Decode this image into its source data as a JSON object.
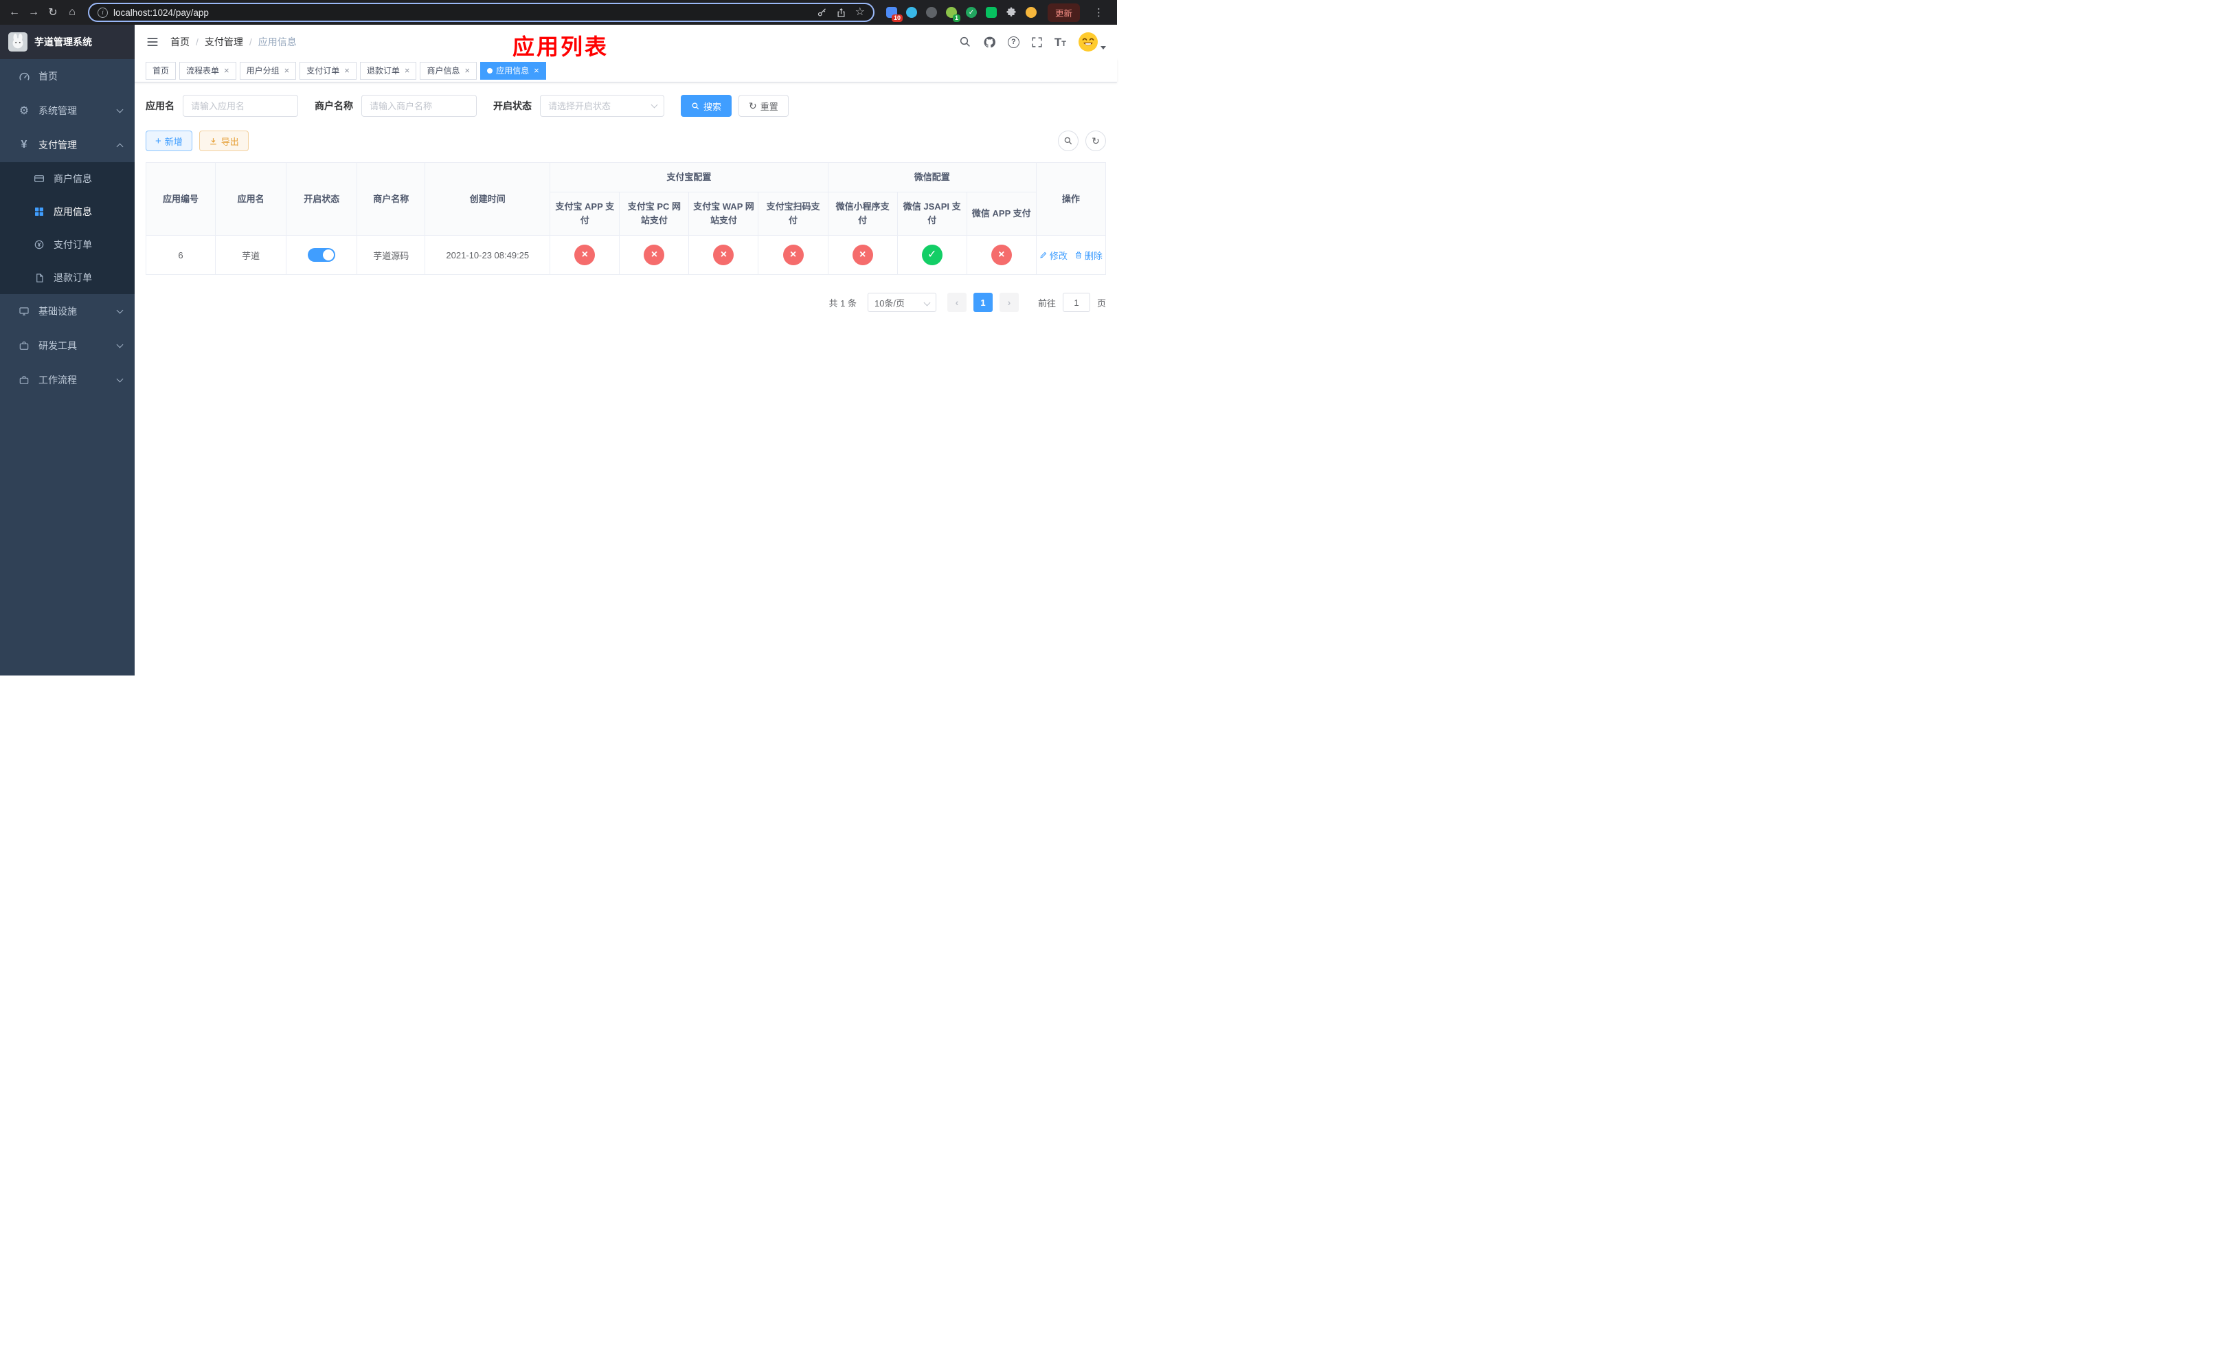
{
  "browser": {
    "url": "localhost:1024/pay/app",
    "update_label": "更新",
    "extension_badge_count": "10",
    "profile_badge_count": "1"
  },
  "sidebar": {
    "title": "芋道管理系统",
    "items": [
      {
        "label": "首页"
      },
      {
        "label": "系统管理"
      },
      {
        "label": "支付管理"
      },
      {
        "label": "基础设施"
      },
      {
        "label": "研发工具"
      },
      {
        "label": "工作流程"
      }
    ],
    "payment_submenu": [
      {
        "label": "商户信息"
      },
      {
        "label": "应用信息"
      },
      {
        "label": "支付订单"
      },
      {
        "label": "退款订单"
      }
    ]
  },
  "header": {
    "breadcrumb": [
      "首页",
      "支付管理",
      "应用信息"
    ],
    "page_title": "应用列表"
  },
  "tabs": [
    {
      "label": "首页"
    },
    {
      "label": "流程表单"
    },
    {
      "label": "用户分组"
    },
    {
      "label": "支付订单"
    },
    {
      "label": "退款订单"
    },
    {
      "label": "商户信息"
    },
    {
      "label": "应用信息"
    }
  ],
  "filters": {
    "app_name_label": "应用名",
    "app_name_placeholder": "请输入应用名",
    "merchant_name_label": "商户名称",
    "merchant_name_placeholder": "请输入商户名称",
    "status_label": "开启状态",
    "status_placeholder": "请选择开启状态",
    "search_label": "搜索",
    "reset_label": "重置"
  },
  "toolbar": {
    "add_label": "新增",
    "export_label": "导出"
  },
  "table": {
    "headers": {
      "app_id": "应用编号",
      "app_name": "应用名",
      "status": "开启状态",
      "merchant_name": "商户名称",
      "create_time": "创建时间",
      "alipay_group": "支付宝配置",
      "wechat_group": "微信配置",
      "alipay_app": "支付宝 APP 支付",
      "alipay_pc": "支付宝 PC 网站支付",
      "alipay_wap": "支付宝 WAP 网站支付",
      "alipay_qr": "支付宝扫码支付",
      "wx_lite": "微信小程序支付",
      "wx_jsapi": "微信 JSAPI 支付",
      "wx_app": "微信 APP 支付",
      "ops": "操作"
    },
    "rows": [
      {
        "app_id": "6",
        "app_name": "芋道",
        "status_on": true,
        "merchant_name": "芋道源码",
        "create_time": "2021-10-23 08:49:25",
        "configs": [
          "no",
          "no",
          "no",
          "no",
          "no",
          "yes",
          "no"
        ],
        "edit_label": "修改",
        "delete_label": "删除"
      }
    ]
  },
  "pagination": {
    "total": "共 1 条",
    "page_size": "10条/页",
    "current_page": "1",
    "goto_label": "前往",
    "goto_value": "1",
    "page_unit": "页"
  },
  "colors": {
    "accent": "#409eff",
    "success": "#13ce66",
    "danger": "#f56c6c",
    "sidebar_bg": "#304156",
    "annotation": "#ff0000"
  }
}
